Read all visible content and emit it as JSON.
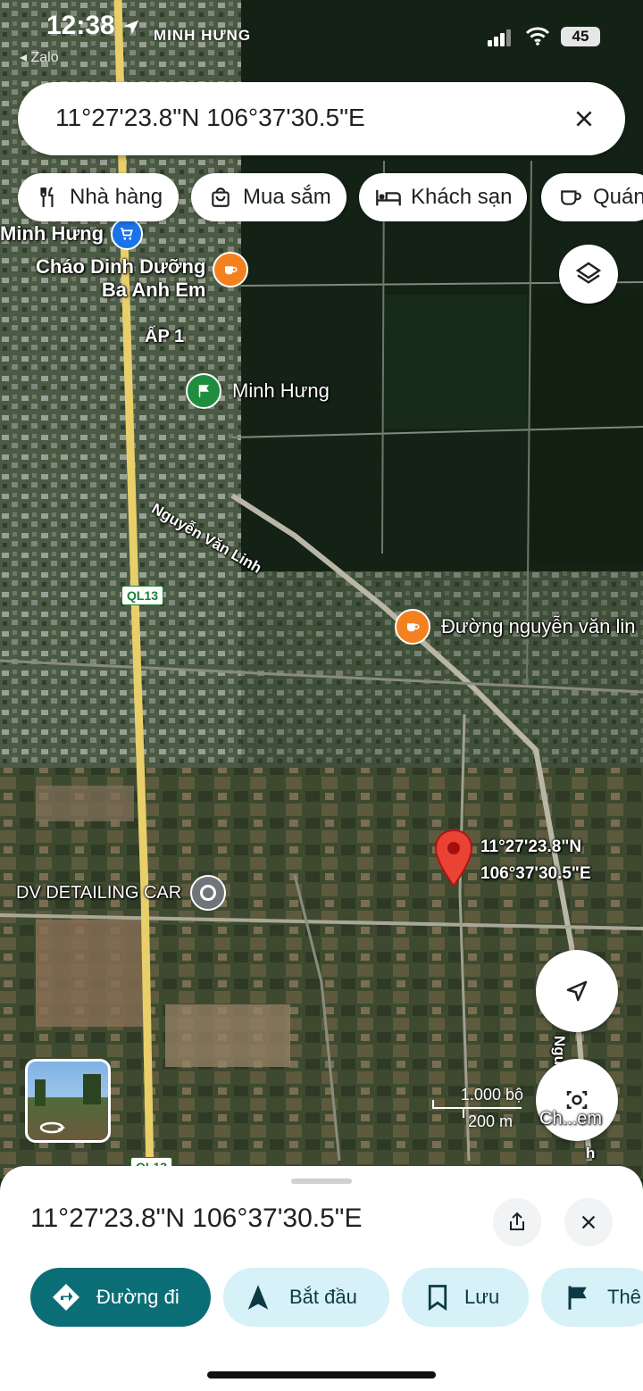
{
  "status_bar": {
    "time": "12:38",
    "back_app": "◂ Zalo",
    "carrier_label": "MINH HƯNG",
    "battery": "45"
  },
  "search": {
    "value": "11°27'23.8\"N 106°37'30.5\"E"
  },
  "chips": [
    {
      "label": "Nhà hàng",
      "icon": "fork-knife-icon"
    },
    {
      "label": "Mua sắm",
      "icon": "shopping-bag-icon"
    },
    {
      "label": "Khách sạn",
      "icon": "bed-icon"
    },
    {
      "label": "Quán",
      "icon": "coffee-cup-icon"
    }
  ],
  "map": {
    "labels": {
      "minh_hung_shop": "Minh Hưng",
      "chao_line1": "Cháo Dinh Dưỡng",
      "chao_line2": "Ba Anh Em",
      "ap1": "ẤP 1",
      "minh_hung_flag": "Minh Hưng",
      "road_nvl": "Nguyễn Văn Linh",
      "ql13_top": "QL13",
      "duong_nvl": "Đường nguyễn văn lin",
      "pin_line1": "11°27'23.8\"N",
      "pin_line2": "106°37'30.5\"E",
      "dv_detailing": "DV DETAILING CAR",
      "road_side": "Ngu",
      "road_side2": "h",
      "ql13_bottom": "QL13",
      "scale_ft": "1.000 bộ",
      "scale_m": "200 m",
      "lens_label": "Ch...em"
    },
    "colors": {
      "pin": "#ea4335",
      "poi_orange": "#f4811f",
      "poi_green": "#1e8e3e",
      "poi_blue": "#1a73e8",
      "poi_gray": "#70757a",
      "road_yellow": "#e8cf6a"
    }
  },
  "sheet": {
    "title": "11°27'23.8\"N 106°37'30.5\"E",
    "actions": [
      {
        "label": "Đường đi",
        "icon": "directions-icon"
      },
      {
        "label": "Bắt đầu",
        "icon": "navigation-arrow-icon"
      },
      {
        "label": "Lưu",
        "icon": "bookmark-icon"
      },
      {
        "label": "Thê",
        "icon": "flag-icon"
      }
    ]
  }
}
